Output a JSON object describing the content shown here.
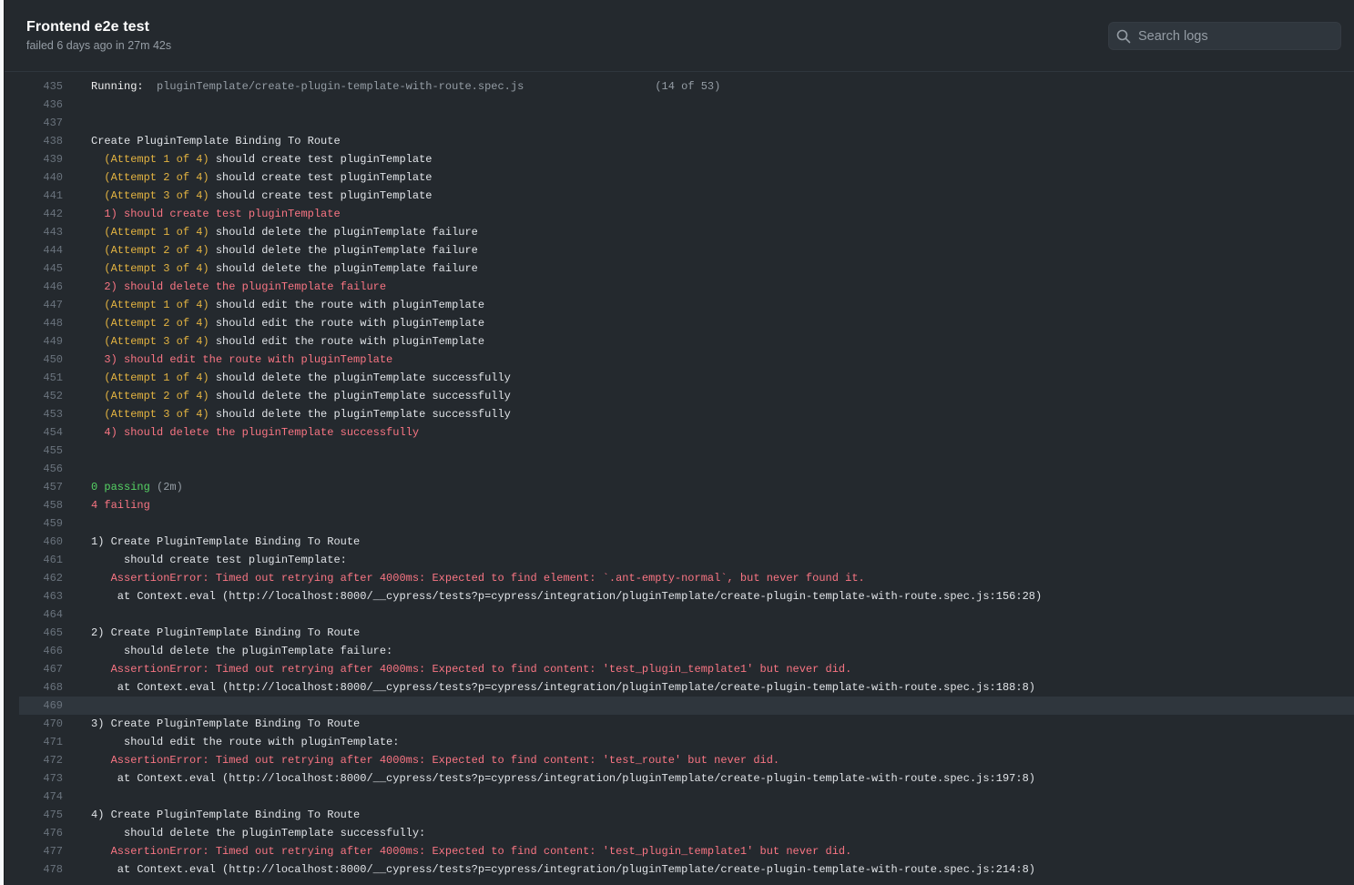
{
  "header": {
    "title": "Frontend e2e test",
    "subtitle": "failed 6 days ago in 27m 42s"
  },
  "search": {
    "placeholder": "Search logs"
  },
  "colors": {
    "default": "#e1e4e8",
    "attempt": "#e3b341",
    "failure": "#f97583",
    "passing": "#56d364",
    "muted": "#959da5",
    "highlight_row": "#2f363d",
    "background": "#24292e"
  },
  "icons": {
    "search": "magnifier-icon"
  },
  "highlighted_line": 469,
  "log_lines": [
    {
      "n": "435",
      "segs": [
        {
          "t": "Running:  ",
          "c": "w"
        },
        {
          "t": "pluginTemplate/create-plugin-template-with-route.spec.js",
          "c": "m"
        },
        {
          "t": "                    ",
          "c": "d"
        },
        {
          "t": "(14 of 53)",
          "c": "m"
        }
      ]
    },
    {
      "n": "436",
      "segs": []
    },
    {
      "n": "437",
      "segs": []
    },
    {
      "n": "438",
      "segs": [
        {
          "t": "Create PluginTemplate Binding To Route",
          "c": "d"
        }
      ]
    },
    {
      "n": "439",
      "segs": [
        {
          "t": "  (Attempt 1 of 4)",
          "c": "y"
        },
        {
          "t": " should create test pluginTemplate",
          "c": "d"
        }
      ]
    },
    {
      "n": "440",
      "segs": [
        {
          "t": "  (Attempt 2 of 4)",
          "c": "y"
        },
        {
          "t": " should create test pluginTemplate",
          "c": "d"
        }
      ]
    },
    {
      "n": "441",
      "segs": [
        {
          "t": "  (Attempt 3 of 4)",
          "c": "y"
        },
        {
          "t": " should create test pluginTemplate",
          "c": "d"
        }
      ]
    },
    {
      "n": "442",
      "segs": [
        {
          "t": "  1) should create test pluginTemplate",
          "c": "r"
        }
      ]
    },
    {
      "n": "443",
      "segs": [
        {
          "t": "  (Attempt 1 of 4)",
          "c": "y"
        },
        {
          "t": " should delete the pluginTemplate failure",
          "c": "d"
        }
      ]
    },
    {
      "n": "444",
      "segs": [
        {
          "t": "  (Attempt 2 of 4)",
          "c": "y"
        },
        {
          "t": " should delete the pluginTemplate failure",
          "c": "d"
        }
      ]
    },
    {
      "n": "445",
      "segs": [
        {
          "t": "  (Attempt 3 of 4)",
          "c": "y"
        },
        {
          "t": " should delete the pluginTemplate failure",
          "c": "d"
        }
      ]
    },
    {
      "n": "446",
      "segs": [
        {
          "t": "  2) should delete the pluginTemplate failure",
          "c": "r"
        }
      ]
    },
    {
      "n": "447",
      "segs": [
        {
          "t": "  (Attempt 1 of 4)",
          "c": "y"
        },
        {
          "t": " should edit the route with pluginTemplate",
          "c": "d"
        }
      ]
    },
    {
      "n": "448",
      "segs": [
        {
          "t": "  (Attempt 2 of 4)",
          "c": "y"
        },
        {
          "t": " should edit the route with pluginTemplate",
          "c": "d"
        }
      ]
    },
    {
      "n": "449",
      "segs": [
        {
          "t": "  (Attempt 3 of 4)",
          "c": "y"
        },
        {
          "t": " should edit the route with pluginTemplate",
          "c": "d"
        }
      ]
    },
    {
      "n": "450",
      "segs": [
        {
          "t": "  3) should edit the route with pluginTemplate",
          "c": "r"
        }
      ]
    },
    {
      "n": "451",
      "segs": [
        {
          "t": "  (Attempt 1 of 4)",
          "c": "y"
        },
        {
          "t": " should delete the pluginTemplate successfully",
          "c": "d"
        }
      ]
    },
    {
      "n": "452",
      "segs": [
        {
          "t": "  (Attempt 2 of 4)",
          "c": "y"
        },
        {
          "t": " should delete the pluginTemplate successfully",
          "c": "d"
        }
      ]
    },
    {
      "n": "453",
      "segs": [
        {
          "t": "  (Attempt 3 of 4)",
          "c": "y"
        },
        {
          "t": " should delete the pluginTemplate successfully",
          "c": "d"
        }
      ]
    },
    {
      "n": "454",
      "segs": [
        {
          "t": "  4) should delete the pluginTemplate successfully",
          "c": "r"
        }
      ]
    },
    {
      "n": "455",
      "segs": []
    },
    {
      "n": "456",
      "segs": []
    },
    {
      "n": "457",
      "segs": [
        {
          "t": "0 passing",
          "c": "g"
        },
        {
          "t": " (2m)",
          "c": "m"
        }
      ]
    },
    {
      "n": "458",
      "segs": [
        {
          "t": "4 failing",
          "c": "r"
        }
      ]
    },
    {
      "n": "459",
      "segs": []
    },
    {
      "n": "460",
      "segs": [
        {
          "t": "1) Create PluginTemplate Binding To Route",
          "c": "d"
        }
      ]
    },
    {
      "n": "461",
      "segs": [
        {
          "t": "     should create test pluginTemplate:",
          "c": "d"
        }
      ]
    },
    {
      "n": "462",
      "segs": [
        {
          "t": "   AssertionError: Timed out retrying after 4000ms: Expected to find element: `.ant-empty-normal`, but never found it.",
          "c": "r"
        }
      ]
    },
    {
      "n": "463",
      "segs": [
        {
          "t": "    at Context.eval (http://localhost:8000/__cypress/tests?p=cypress/integration/pluginTemplate/create-plugin-template-with-route.spec.js:156:28)",
          "c": "d"
        }
      ]
    },
    {
      "n": "464",
      "segs": []
    },
    {
      "n": "465",
      "segs": [
        {
          "t": "2) Create PluginTemplate Binding To Route",
          "c": "d"
        }
      ]
    },
    {
      "n": "466",
      "segs": [
        {
          "t": "     should delete the pluginTemplate failure:",
          "c": "d"
        }
      ]
    },
    {
      "n": "467",
      "segs": [
        {
          "t": "   AssertionError: Timed out retrying after 4000ms: Expected to find content: 'test_plugin_template1' but never did.",
          "c": "r"
        }
      ]
    },
    {
      "n": "468",
      "segs": [
        {
          "t": "    at Context.eval (http://localhost:8000/__cypress/tests?p=cypress/integration/pluginTemplate/create-plugin-template-with-route.spec.js:188:8)",
          "c": "d"
        }
      ]
    },
    {
      "n": "469",
      "segs": []
    },
    {
      "n": "470",
      "segs": [
        {
          "t": "3) Create PluginTemplate Binding To Route",
          "c": "d"
        }
      ]
    },
    {
      "n": "471",
      "segs": [
        {
          "t": "     should edit the route with pluginTemplate:",
          "c": "d"
        }
      ]
    },
    {
      "n": "472",
      "segs": [
        {
          "t": "   AssertionError: Timed out retrying after 4000ms: Expected to find content: 'test_route' but never did.",
          "c": "r"
        }
      ]
    },
    {
      "n": "473",
      "segs": [
        {
          "t": "    at Context.eval (http://localhost:8000/__cypress/tests?p=cypress/integration/pluginTemplate/create-plugin-template-with-route.spec.js:197:8)",
          "c": "d"
        }
      ]
    },
    {
      "n": "474",
      "segs": []
    },
    {
      "n": "475",
      "segs": [
        {
          "t": "4) Create PluginTemplate Binding To Route",
          "c": "d"
        }
      ]
    },
    {
      "n": "476",
      "segs": [
        {
          "t": "     should delete the pluginTemplate successfully:",
          "c": "d"
        }
      ]
    },
    {
      "n": "477",
      "segs": [
        {
          "t": "   AssertionError: Timed out retrying after 4000ms: Expected to find content: 'test_plugin_template1' but never did.",
          "c": "r"
        }
      ]
    },
    {
      "n": "478",
      "segs": [
        {
          "t": "    at Context.eval (http://localhost:8000/__cypress/tests?p=cypress/integration/pluginTemplate/create-plugin-template-with-route.spec.js:214:8)",
          "c": "d"
        }
      ]
    }
  ]
}
